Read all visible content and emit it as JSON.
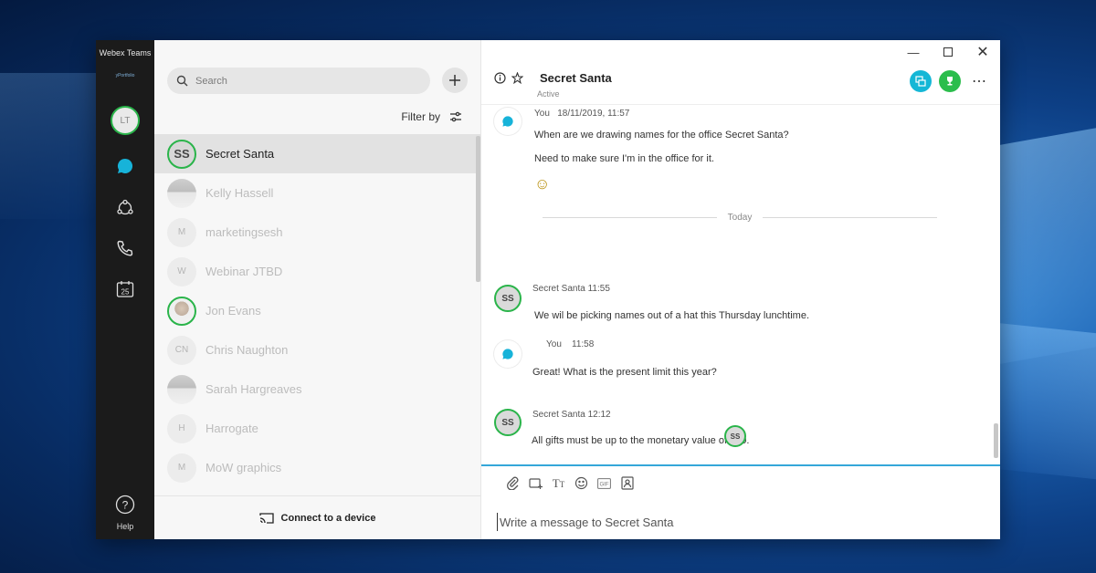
{
  "window": {
    "app_title": "Webex Teams",
    "brand_text": "yPortfolio",
    "controls": [
      "minimize",
      "maximize",
      "close"
    ]
  },
  "rail": {
    "user_initials": "LT",
    "calendar_day": "25",
    "help_label": "Help",
    "icons": [
      "chat-icon",
      "teams-icon",
      "phone-icon",
      "calendar-icon",
      "help-icon"
    ]
  },
  "list": {
    "search_placeholder": "Search",
    "filter_label": "Filter by",
    "connect_label": "Connect to a device",
    "contacts": [
      {
        "initials": "SS",
        "name": "Secret Santa",
        "active": true
      },
      {
        "initials": "",
        "name": "Kelly Hassell",
        "photo": true
      },
      {
        "initials": "M",
        "name": "marketingsesh"
      },
      {
        "initials": "W",
        "name": "Webinar JTBD"
      },
      {
        "initials": "",
        "name": "Jon Evans",
        "photo": true
      },
      {
        "initials": "CN",
        "name": "Chris Naughton"
      },
      {
        "initials": "",
        "name": "Sarah Hargreaves",
        "photo": true
      },
      {
        "initials": "H",
        "name": "Harrogate"
      },
      {
        "initials": "M",
        "name": "MoW graphics"
      }
    ]
  },
  "chat": {
    "title": "Secret Santa",
    "status": "Active",
    "day_separator": "Today",
    "messages": [
      {
        "author": "You",
        "time": "18/11/2019, 11:57",
        "lines": [
          "When are we drawing names for the office Secret Santa?",
          "Need to make sure I'm in the office for it."
        ],
        "emoji": "☺"
      },
      {
        "author": "Secret Santa",
        "time": "11:55",
        "lines": [
          "We wil be picking names out of a hat this Thursday lunchtime."
        ]
      },
      {
        "author": "You",
        "time": "11:58",
        "lines": [
          "Great! What is the present limit this year?"
        ]
      },
      {
        "author": "Secret Santa",
        "time": "12:12",
        "lines": [
          "All gifts must be up to the monetary value of £10."
        ]
      }
    ],
    "read_receipt_initials": "SS",
    "composer_placeholder": "Write a message to Secret Santa"
  },
  "colors": {
    "accent_green": "#2ab44a",
    "accent_blue": "#35a7d9",
    "cyan_button": "#15b7d6",
    "green_button": "#2bbd4c",
    "rail_bg": "#1b1b1b"
  }
}
